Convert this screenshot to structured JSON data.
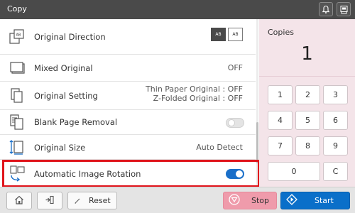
{
  "titlebar": {
    "title": "Copy",
    "icons": [
      "bell-icon",
      "device-status-icon"
    ]
  },
  "settings": [
    {
      "label": "Original Direction",
      "icon": "original-direction-icon",
      "value": "",
      "direction_options": [
        "AB",
        "AB"
      ]
    },
    {
      "label": "Mixed Original",
      "icon": "mixed-original-icon",
      "value": "OFF"
    },
    {
      "label": "Original Setting",
      "icon": "original-setting-icon",
      "value_lines": [
        "Thin Paper Original : OFF",
        "Z-Folded Original : OFF"
      ]
    },
    {
      "label": "Blank Page Removal",
      "icon": "blank-page-removal-icon",
      "toggle": "off"
    },
    {
      "label": "Original Size",
      "icon": "original-size-icon",
      "value": "Auto Detect"
    },
    {
      "label": "Automatic Image Rotation",
      "icon": "image-rotation-icon",
      "toggle": "on",
      "highlighted": true
    }
  ],
  "copies": {
    "label": "Copies",
    "value": "1"
  },
  "keypad": [
    "1",
    "2",
    "3",
    "4",
    "5",
    "6",
    "7",
    "8",
    "9",
    "0",
    "C"
  ],
  "bottom": {
    "home_icon": "home-icon",
    "login_icon": "login-icon",
    "reset_label": "Reset",
    "stop_label": "Stop",
    "start_label": "Start"
  },
  "colors": {
    "titlebar": "#4a4a4a",
    "highlight": "#e0141b",
    "toggle_on": "#1a6fc9",
    "stop": "#ef9bab",
    "start": "#0a6fc9",
    "panel": "#f4e4e9"
  }
}
